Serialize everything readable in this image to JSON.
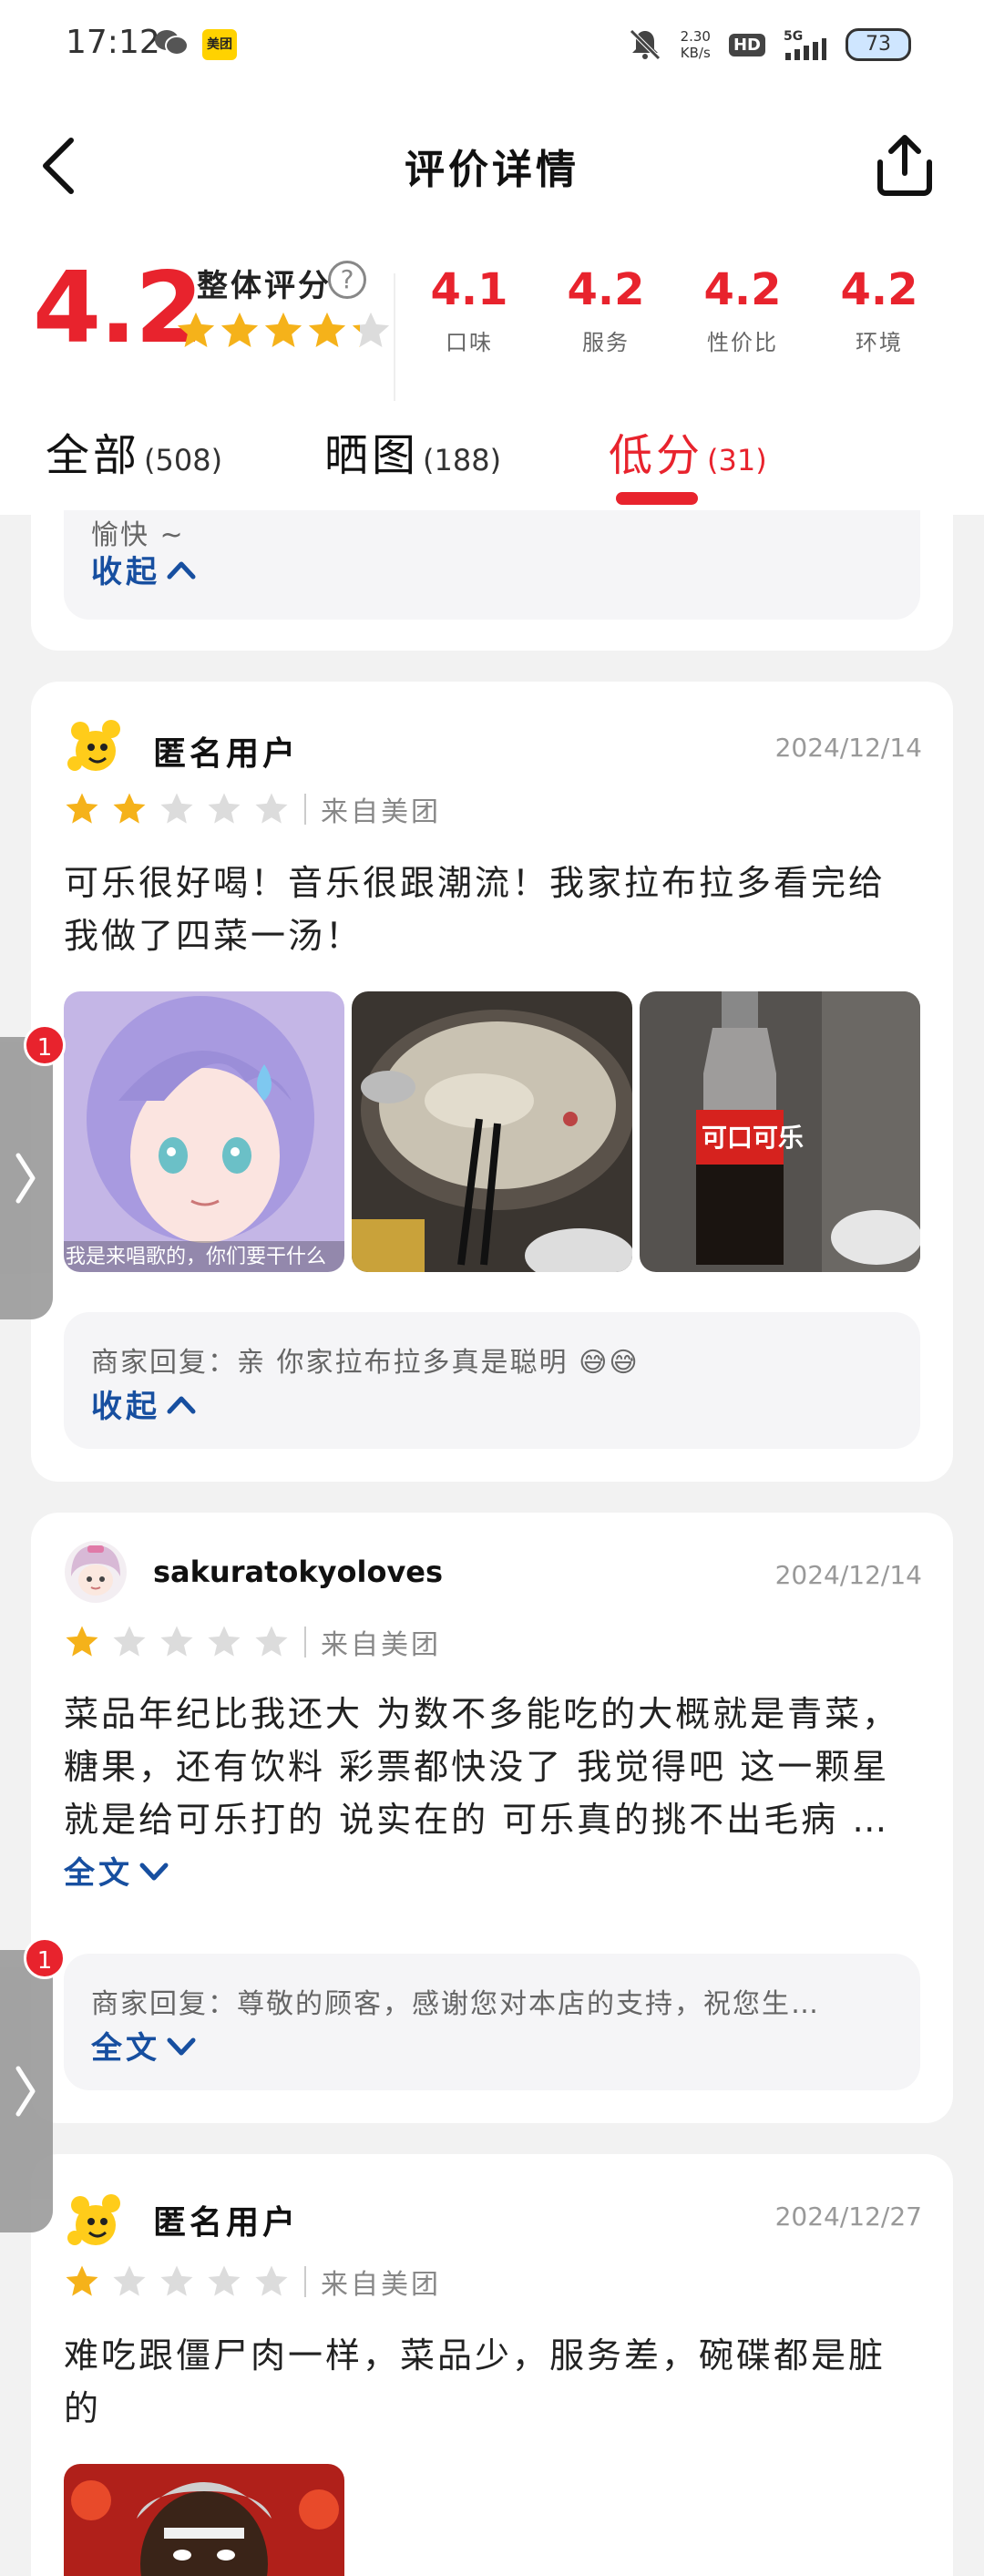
{
  "status_bar": {
    "time": "17:12",
    "net_speed": "2.30",
    "net_unit": "KB/s",
    "hd": "HD",
    "signal": "5G",
    "battery": "73",
    "meituan_icon_label": "美团"
  },
  "header": {
    "title": "评价详情",
    "overall_score": "4.2",
    "overall_label": "整体评分",
    "help": "?",
    "overall_stars": 4.2,
    "subscores": [
      {
        "value": "4.1",
        "label": "口味"
      },
      {
        "value": "4.2",
        "label": "服务"
      },
      {
        "value": "4.2",
        "label": "性价比"
      },
      {
        "value": "4.2",
        "label": "环境"
      }
    ],
    "tabs": [
      {
        "name": "全部",
        "count": "(508)"
      },
      {
        "name": "晒图",
        "count": "(188)"
      },
      {
        "name": "低分",
        "count": "(31)"
      }
    ],
    "active_tab": 2
  },
  "top_partial_card": {
    "tail_text": "愉快 ~",
    "collapse_label": "收起"
  },
  "reviews": [
    {
      "user": "匿名用户",
      "date": "2024/12/14",
      "rating": 2,
      "source": "来自美团",
      "text": "可乐很好喝！音乐很跟潮流！我家拉布拉多看完给我做了四菜一汤！",
      "photo_caption": "我是来唱歌的，你们要干什么",
      "reply": "商家回复：亲 你家拉布拉多真是聪明 😅😅",
      "reply_toggle": "收起"
    },
    {
      "user": "sakuratokyoloves",
      "date": "2024/12/14",
      "rating": 1,
      "source": "来自美团",
      "text": "菜品年纪比我还大 为数不多能吃的大概就是青菜，糖果，还有饮料 彩票都快没了 我觉得吧 这一颗星就是给可乐打的 说实在的 可乐真的挑不出毛病 …",
      "text_toggle": "全文",
      "reply": "商家回复：尊敬的顾客，感谢您对本店的支持，祝您生…",
      "reply_toggle": "全文"
    },
    {
      "user": "匿名用户",
      "date": "2024/12/27",
      "rating": 1,
      "source": "来自美团",
      "text": "难吃跟僵尸肉一样，菜品少，服务差，碗碟都是脏的"
    }
  ],
  "side_tabs": [
    {
      "badge": "1"
    },
    {
      "badge": "1"
    }
  ],
  "colors": {
    "accent_red": "#e8232d",
    "link_blue": "#174fa0",
    "star_gold": "#f5b21a",
    "star_empty": "#dcdcdc"
  }
}
